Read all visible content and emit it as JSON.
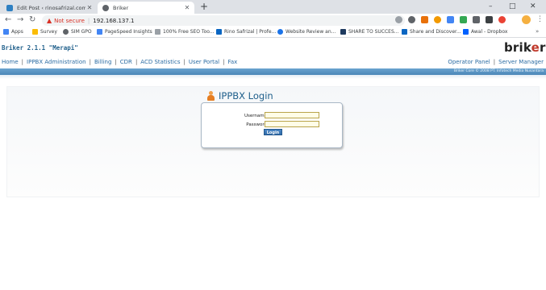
{
  "browser": {
    "tabs": [
      {
        "title": "Edit Post ‹ rinosafrizal.com — W",
        "active": false
      },
      {
        "title": "Briker",
        "active": true
      }
    ],
    "new_tab": "+",
    "window_controls": [
      "–",
      "□",
      "✕"
    ],
    "nav": {
      "back": "←",
      "forward": "→",
      "reload": "↻"
    },
    "address": {
      "security_icon": "warning-icon",
      "security_text": "Not secure",
      "separator": "|",
      "url": "192.168.137.1"
    },
    "bookmarks": [
      "Apps",
      "Survey",
      "SIM GPO",
      "PageSpeed Insights",
      "100% Free SEO Too...",
      "Rino Safrizal | Profe...",
      "Website Review an...",
      "SHARE TO SUCCES...",
      "Share and Discover...",
      "Awal - Dropbox"
    ],
    "bookmarks_more": "»"
  },
  "page": {
    "version": "Briker 2.1.1 \"Merapi\"",
    "logo": {
      "main": "brik",
      "accent": "e",
      "tail": "r"
    },
    "nav_left": [
      "Home",
      "IPPBX Administration",
      "Billing",
      "CDR",
      "ACD Statistics",
      "User Portal",
      "Fax"
    ],
    "nav_right": [
      "Operator Panel",
      "Server Manager"
    ],
    "separator": "|",
    "copyright": "Briker Core © 2008 PT. Infotech Media Nusantara",
    "login": {
      "title": "IPPBX Login",
      "username_label": "Username",
      "password_label": "Password",
      "username_value": "",
      "password_value": "",
      "button": "Login"
    }
  },
  "colors": {
    "accent_blue": "#1f5f8b",
    "link_blue": "#2b6ca3",
    "band_blue": "#5b96c4",
    "logo_accent": "#c0392b",
    "warning_red": "#d93025"
  }
}
